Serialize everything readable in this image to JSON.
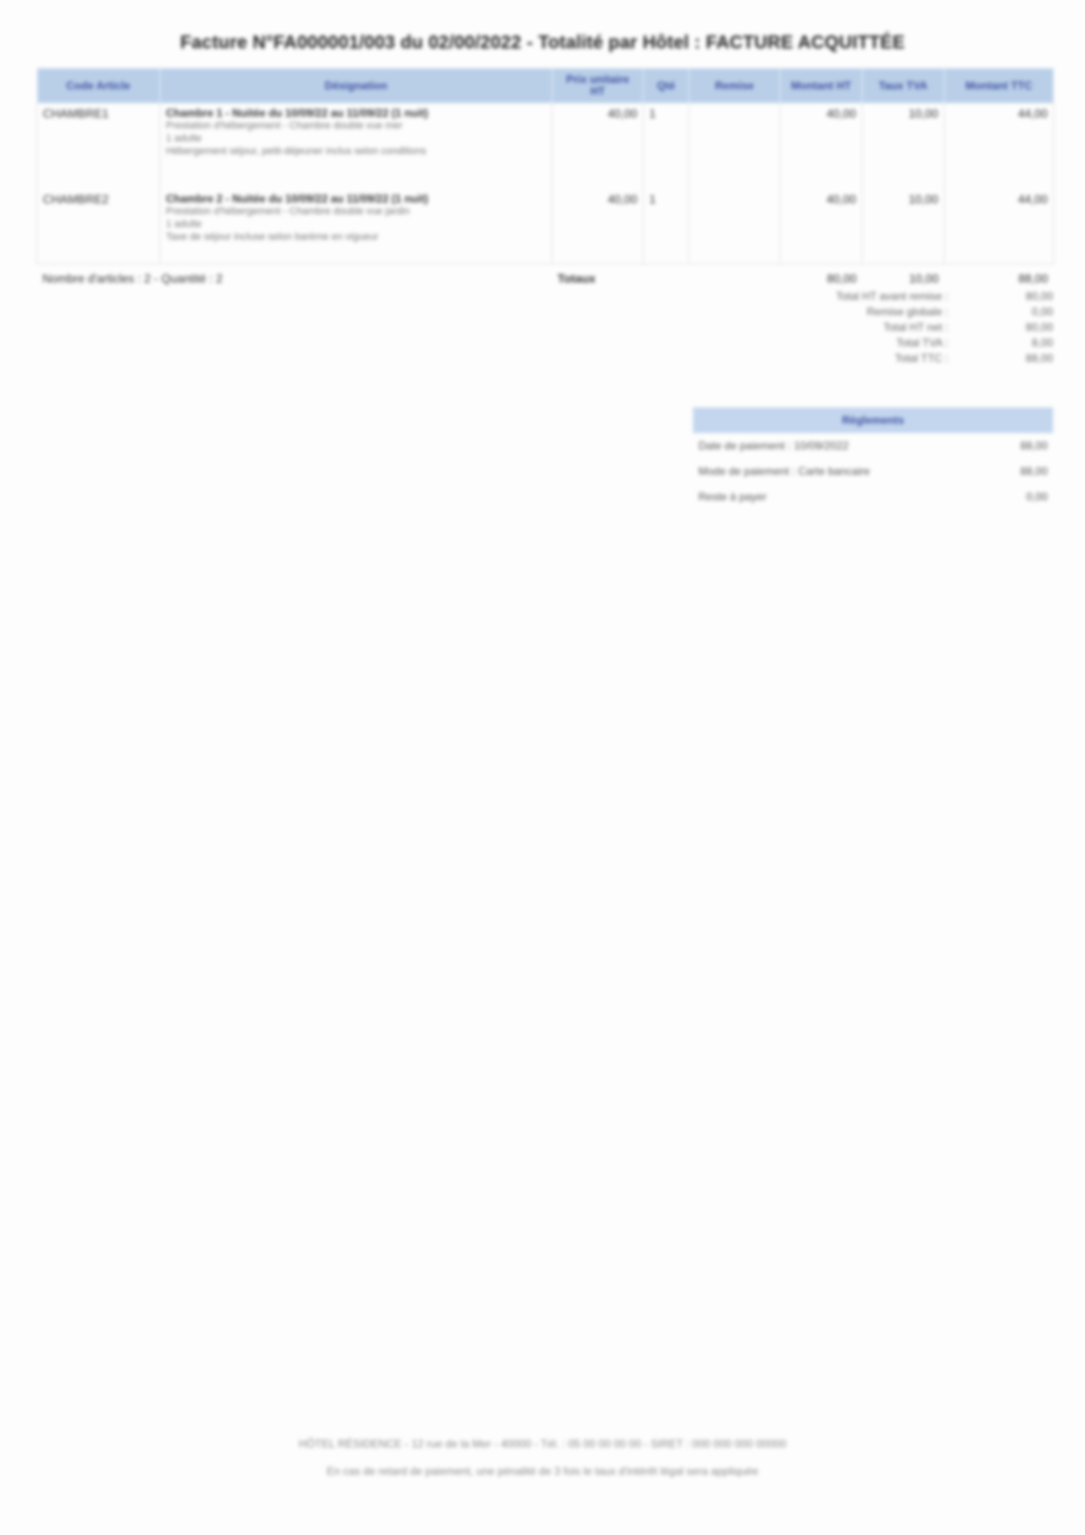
{
  "document": {
    "title": "Facture N°FA000001/003 du 02/00/2022 - Totalité par Hôtel : FACTURE ACQUITTÉE"
  },
  "table": {
    "headers": [
      "Code Article",
      "Désignation",
      "Prix unitaire HT",
      "Qté",
      "Remise",
      "Montant HT",
      "Taux TVA",
      "Montant TTC"
    ],
    "rows": [
      {
        "code": "CHAMBRE1",
        "title": "Chambre 1 - Nuitée du 10/09/22 au 11/09/22 (1 nuit)",
        "lines": [
          "Prestation d'hébergement - Chambre double vue mer",
          "1 adulte",
          "Hébergement séjour, petit-déjeuner inclus selon conditions"
        ],
        "pu": "40,00",
        "qte": "1",
        "remise": "",
        "ht": "40,00",
        "taux": "10,00",
        "ttc": "44,00"
      },
      {
        "code": "CHAMBRE2",
        "title": "Chambre 2 - Nuitée du 10/09/22 au 11/09/22 (1 nuit)",
        "lines": [
          "Prestation d'hébergement - Chambre double vue jardin",
          "1 adulte",
          "Taxe de séjour incluse selon barème en vigueur"
        ],
        "pu": "40,00",
        "qte": "1",
        "remise": "",
        "ht": "40,00",
        "taux": "10,00",
        "ttc": "44,00"
      }
    ],
    "footer_left": "Nombre d'articles : 2 - Quantité : 2",
    "total_label": "Totaux",
    "total_ht": "80,00",
    "total_taux": "10,00",
    "total_ttc": "88,00"
  },
  "recap": [
    {
      "label": "Total HT avant remise :",
      "value": "80,00"
    },
    {
      "label": "Remise globale :",
      "value": "0,00"
    },
    {
      "label": "Total HT net :",
      "value": "80,00"
    },
    {
      "label": "Total TVA :",
      "value": "8,00"
    },
    {
      "label": "Total TTC :",
      "value": "88,00"
    }
  ],
  "settlement": {
    "header": "Règlements",
    "rows": [
      {
        "label": "Date de paiement : 10/09/2022",
        "value": "88,00"
      },
      {
        "label": "Mode de paiement : Carte bancaire",
        "value": "88,00"
      },
      {
        "label": "Reste à payer",
        "value": "0,00"
      }
    ]
  },
  "footer": {
    "line1": "HÔTEL RÉSIDENCE - 12 rue de la Mer - 40000 - Tél. : 05 00 00 00 00 - SIRET : 000 000 000 00000",
    "line2": "En cas de retard de paiement, une pénalité de 3 fois le taux d'intérêt légal sera appliquée"
  }
}
